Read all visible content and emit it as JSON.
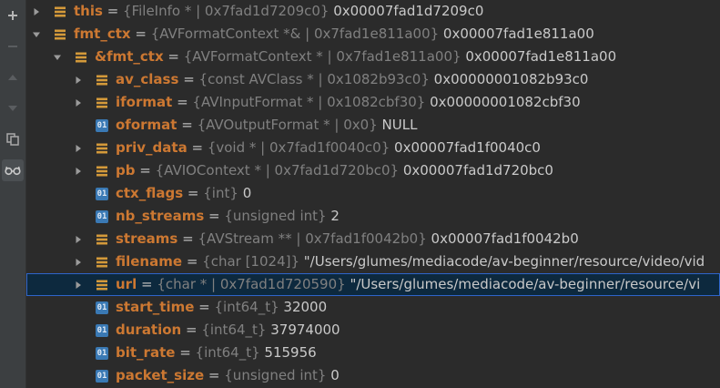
{
  "toolbar": {
    "buttons": [
      {
        "icon": "plus-icon"
      },
      {
        "icon": "minus-icon"
      },
      {
        "icon": "arrow-up-icon"
      },
      {
        "icon": "arrow-down-icon"
      },
      {
        "icon": "copy-icon"
      },
      {
        "icon": "glasses-icon"
      }
    ]
  },
  "rows": [
    {
      "depth": 0,
      "arrow": "right",
      "icon": "field",
      "name": "this",
      "type": "{FileInfo * | 0x7fad1d7209c0}",
      "value": "0x00007fad1d7209c0"
    },
    {
      "depth": 0,
      "arrow": "down",
      "icon": "field",
      "name": "fmt_ctx",
      "type": "{AVFormatContext *& | 0x7fad1e811a00}",
      "value": "0x00007fad1e811a00"
    },
    {
      "depth": 1,
      "arrow": "down",
      "icon": "field",
      "name": "&fmt_ctx",
      "type": "{AVFormatContext * | 0x7fad1e811a00}",
      "value": "0x00007fad1e811a00"
    },
    {
      "depth": 2,
      "arrow": "right",
      "icon": "field",
      "name": "av_class",
      "type": "{const AVClass * | 0x1082b93c0}",
      "value": "0x00000001082b93c0"
    },
    {
      "depth": 2,
      "arrow": "right",
      "icon": "field",
      "name": "iformat",
      "type": "{AVInputFormat * | 0x1082cbf30}",
      "value": "0x00000001082cbf30"
    },
    {
      "depth": 2,
      "arrow": "none",
      "icon": "prim",
      "name": "oformat",
      "type": "{AVOutputFormat * | 0x0}",
      "value": "NULL"
    },
    {
      "depth": 2,
      "arrow": "right",
      "icon": "field",
      "name": "priv_data",
      "type": "{void * | 0x7fad1f0040c0}",
      "value": "0x00007fad1f0040c0"
    },
    {
      "depth": 2,
      "arrow": "right",
      "icon": "field",
      "name": "pb",
      "type": "{AVIOContext * | 0x7fad1d720bc0}",
      "value": "0x00007fad1d720bc0"
    },
    {
      "depth": 2,
      "arrow": "none",
      "icon": "prim",
      "name": "ctx_flags",
      "type": "{int}",
      "value": "0"
    },
    {
      "depth": 2,
      "arrow": "none",
      "icon": "prim",
      "name": "nb_streams",
      "type": "{unsigned int}",
      "value": "2"
    },
    {
      "depth": 2,
      "arrow": "right",
      "icon": "field",
      "name": "streams",
      "type": "{AVStream ** | 0x7fad1f0042b0}",
      "value": "0x00007fad1f0042b0"
    },
    {
      "depth": 2,
      "arrow": "right",
      "icon": "field",
      "name": "filename",
      "type": "{char [1024]}",
      "value": "\"/Users/glumes/mediacode/av-beginner/resource/video/vid"
    },
    {
      "depth": 2,
      "arrow": "right",
      "icon": "field",
      "name": "url",
      "type": "{char * | 0x7fad1d720590}",
      "value": "\"/Users/glumes/mediacode/av-beginner/resource/vi",
      "selected": true
    },
    {
      "depth": 2,
      "arrow": "none",
      "icon": "prim",
      "name": "start_time",
      "type": "{int64_t}",
      "value": "32000"
    },
    {
      "depth": 2,
      "arrow": "none",
      "icon": "prim",
      "name": "duration",
      "type": "{int64_t}",
      "value": "37974000"
    },
    {
      "depth": 2,
      "arrow": "none",
      "icon": "prim",
      "name": "bit_rate",
      "type": "{int64_t}",
      "value": "515956"
    },
    {
      "depth": 2,
      "arrow": "none",
      "icon": "prim",
      "name": "packet_size",
      "type": "{unsigned int}",
      "value": "0"
    }
  ],
  "labels": {
    "eq": " = ",
    "prim_icon_text": "01"
  }
}
